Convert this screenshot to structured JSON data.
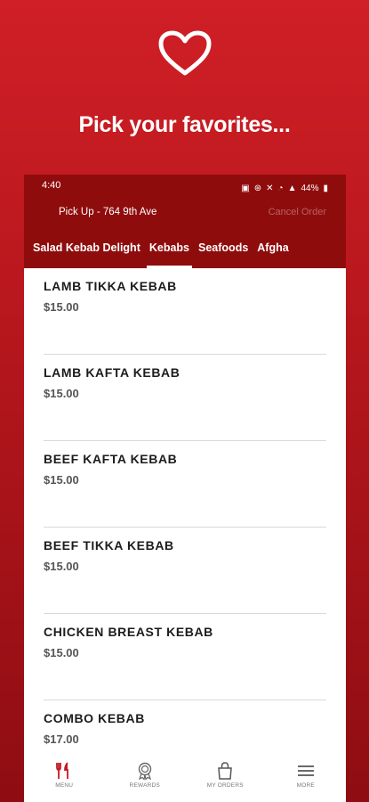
{
  "promo": {
    "headline": "Pick your favorites...",
    "accent_color": "#c41a20"
  },
  "status_bar": {
    "time": "4:40",
    "battery": "44%"
  },
  "header": {
    "pickup_label": "Pick Up - 764 9th Ave",
    "cancel_label": "Cancel Order"
  },
  "tabs": [
    {
      "label": "Salad Kebab Delight",
      "active": false
    },
    {
      "label": "Kebabs",
      "active": true
    },
    {
      "label": "Seafoods",
      "active": false
    },
    {
      "label": "Afgha",
      "active": false
    }
  ],
  "items": [
    {
      "name": "LAMB TIKKA KEBAB",
      "price": "$15.00"
    },
    {
      "name": "LAMB KAFTA KEBAB",
      "price": "$15.00"
    },
    {
      "name": "BEEF KAFTA KEBAB",
      "price": "$15.00"
    },
    {
      "name": "BEEF TIKKA KEBAB",
      "price": "$15.00"
    },
    {
      "name": "CHICKEN BREAST KEBAB",
      "price": "$15.00"
    },
    {
      "name": "COMBO KEBAB",
      "price": "$17.00"
    }
  ],
  "bottom_nav": [
    {
      "label": "MENU",
      "icon": "fork-knife-icon"
    },
    {
      "label": "REWARDS",
      "icon": "award-icon"
    },
    {
      "label": "MY ORDERS",
      "icon": "bag-icon"
    },
    {
      "label": "MORE",
      "icon": "hamburger-icon"
    }
  ]
}
